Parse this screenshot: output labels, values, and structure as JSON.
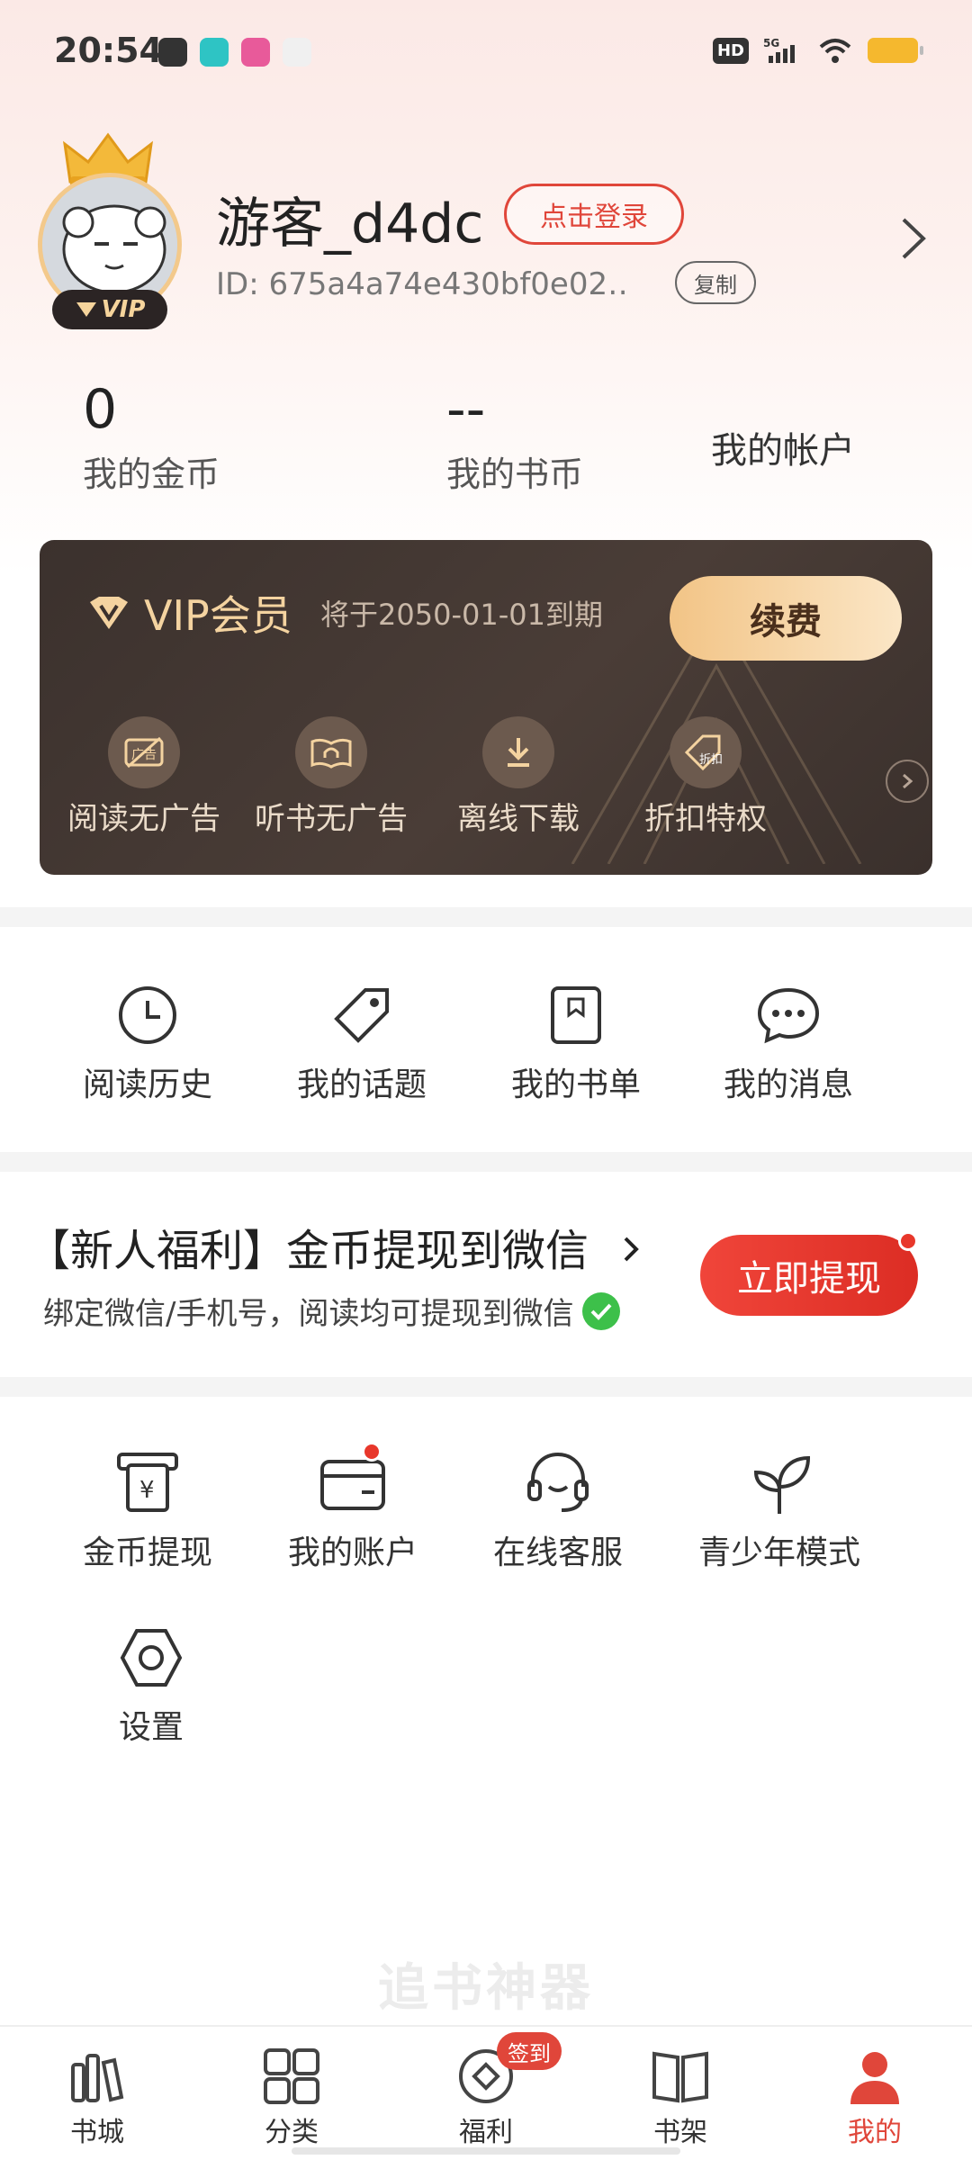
{
  "status_bar": {
    "time": "20:54",
    "hd": "HD",
    "network": "5G",
    "accent_battery": "#f5b82e"
  },
  "profile": {
    "username": "游客_d4dc",
    "login_label": "点击登录",
    "user_id": "ID: 675a4a74e430bf0e02…",
    "copy_label": "复制",
    "vip_badge": "VIP"
  },
  "stats": {
    "coins_value": "0",
    "coins_label": "我的金币",
    "book_coins_value": "--",
    "book_coins_label": "我的书币",
    "account_label": "我的帐户"
  },
  "vip_card": {
    "title": "VIP会员",
    "expire": "将于2050-01-01到期",
    "renew_label": "续费",
    "perks": [
      {
        "label": "阅读无广告",
        "icon": "no-ad-icon"
      },
      {
        "label": "听书无广告",
        "icon": "audiobook-icon"
      },
      {
        "label": "离线下载",
        "icon": "download-icon"
      },
      {
        "label": "折扣特权",
        "icon": "discount-tag-icon",
        "icon_text": "折扣"
      }
    ],
    "perk_ad_text": "广告"
  },
  "quick_menu": [
    {
      "label": "阅读历史",
      "icon": "clock-icon"
    },
    {
      "label": "我的话题",
      "icon": "tag-icon"
    },
    {
      "label": "我的书单",
      "icon": "booklist-icon"
    },
    {
      "label": "我的消息",
      "icon": "chat-icon"
    }
  ],
  "promo": {
    "title": "【新人福利】金币提现到微信",
    "subtitle": "绑定微信/手机号，阅读均可提现到微信",
    "button_label": "立即提现",
    "accent": "#e8372b"
  },
  "tools_menu": [
    {
      "label": "金币提现",
      "icon": "coin-withdraw-icon",
      "icon_text": "¥"
    },
    {
      "label": "我的账户",
      "icon": "wallet-icon"
    },
    {
      "label": "在线客服",
      "icon": "headset-icon"
    },
    {
      "label": "青少年模式",
      "icon": "sprout-icon"
    },
    {
      "label": "设置",
      "icon": "settings-icon"
    }
  ],
  "watermark": "追书神器",
  "bottom_nav": {
    "items": [
      {
        "label": "书城",
        "icon": "bookstore-icon"
      },
      {
        "label": "分类",
        "icon": "category-icon"
      },
      {
        "label": "福利",
        "icon": "welfare-icon"
      },
      {
        "label": "书架",
        "icon": "bookshelf-icon"
      },
      {
        "label": "我的",
        "icon": "profile-icon"
      }
    ],
    "sign_badge": "签到",
    "active_color": "#e0463a"
  }
}
